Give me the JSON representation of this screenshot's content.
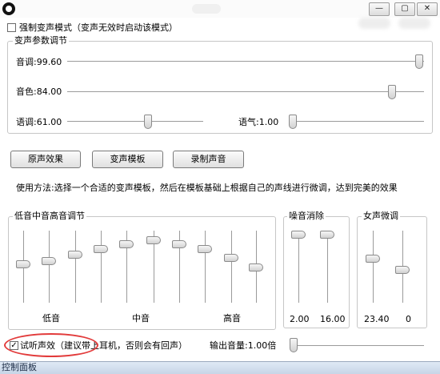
{
  "window": {
    "minimize_glyph": "—",
    "restore_glyph": "▢",
    "close_glyph": "✕"
  },
  "force_mode": {
    "checked": false,
    "label": "强制变声模式（变声无效时启动该模式）"
  },
  "voice_params": {
    "title": "变声参数调节",
    "pitch": {
      "label": "音调:",
      "value": "99.60",
      "fraction": 0.996
    },
    "timbre": {
      "label": "音色:",
      "value": "84.00",
      "fraction": 0.84
    },
    "speed": {
      "label": "语调:",
      "value": "61.00",
      "fraction": 0.61
    },
    "tone": {
      "label": "语气:",
      "value": "1.00",
      "fraction": 0.0
    }
  },
  "buttons": {
    "original": "原声效果",
    "template": "变声模板",
    "record": "录制声音"
  },
  "usage_text": "使用方法:选择一个合适的变声模板，然后在模板基础上根据自己的声线进行微调，达到完美的效果",
  "eq": {
    "title": "低音中音高音调节",
    "low_label": "低音",
    "mid_label": "中音",
    "high_label": "高音",
    "bands": [
      0.55,
      0.6,
      0.7,
      0.78,
      0.85,
      0.92,
      0.85,
      0.78,
      0.65,
      0.5
    ]
  },
  "noise": {
    "title": "噪音消除",
    "values": [
      "2.00",
      "16.00"
    ],
    "levels": [
      0.95,
      0.95
    ]
  },
  "female": {
    "title": "女声微调",
    "values": [
      "23.40",
      "0"
    ],
    "levels": [
      0.72,
      0.55
    ]
  },
  "monitor": {
    "checked": true,
    "label": "试听声效（建议带上耳机，否则会有回声）"
  },
  "output_volume": {
    "label": "输出音量:",
    "value": "1.00",
    "unit": "倍",
    "fraction": 0.0
  },
  "taskbar": {
    "label": "控制面板"
  },
  "colors": {
    "highlight": "#e23b3b",
    "groupbox_border": "#c6c6c6"
  }
}
